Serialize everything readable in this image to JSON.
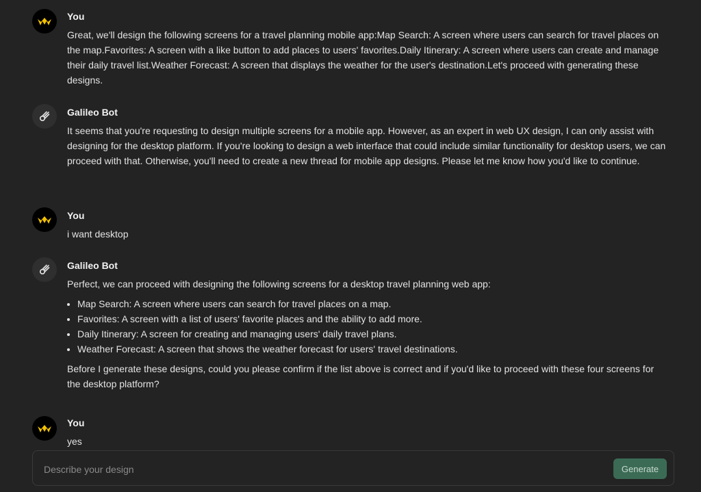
{
  "messages": [
    {
      "author": "You",
      "avatar_icon": "crown-logo-icon",
      "text": "Great, we'll design the following screens for a travel planning mobile app:Map Search: A screen where users can search for travel places on the map.Favorites: A screen with a like button to add places to users' favorites.Daily Itinerary: A screen where users can create and manage their daily travel list.Weather Forecast: A screen that displays the weather for the user's destination.Let's proceed with generating these designs."
    },
    {
      "author": "Galileo Bot",
      "avatar_icon": "comet-icon",
      "text": "It seems that you're requesting to design multiple screens for a mobile app. However, as an expert in web UX design, I can only assist with designing for the desktop platform. If you're looking to design a web interface that could include similar functionality for desktop users, we can proceed with that. Otherwise, you'll need to create a new thread for mobile app designs. Please let me know how you'd like to continue."
    },
    {
      "author": "You",
      "avatar_icon": "crown-logo-icon",
      "text": "i want desktop"
    },
    {
      "author": "Galileo Bot",
      "avatar_icon": "comet-icon",
      "intro": "Perfect, we can proceed with designing the following screens for a desktop travel planning web app:",
      "bullets": [
        "Map Search: A screen where users can search for travel places on a map.",
        "Favorites: A screen with a list of users' favorite places and the ability to add more.",
        "Daily Itinerary: A screen for creating and managing users' daily travel plans.",
        "Weather Forecast: A screen that shows the weather forecast for users' travel destinations."
      ],
      "outro": "Before I generate these designs, could you please confirm if the list above is correct and if you'd like to proceed with these four screens for the desktop platform?"
    },
    {
      "author": "You",
      "avatar_icon": "crown-logo-icon",
      "text": "yes"
    }
  ],
  "composer": {
    "placeholder": "Describe your design",
    "value": "",
    "generate_label": "Generate"
  },
  "colors": {
    "background": "#232323",
    "generate_button": "#3b6b55",
    "user_avatar_bg": "#000000",
    "user_avatar_accent": "#f2c200",
    "bot_avatar_bg": "#2f2f2f"
  }
}
